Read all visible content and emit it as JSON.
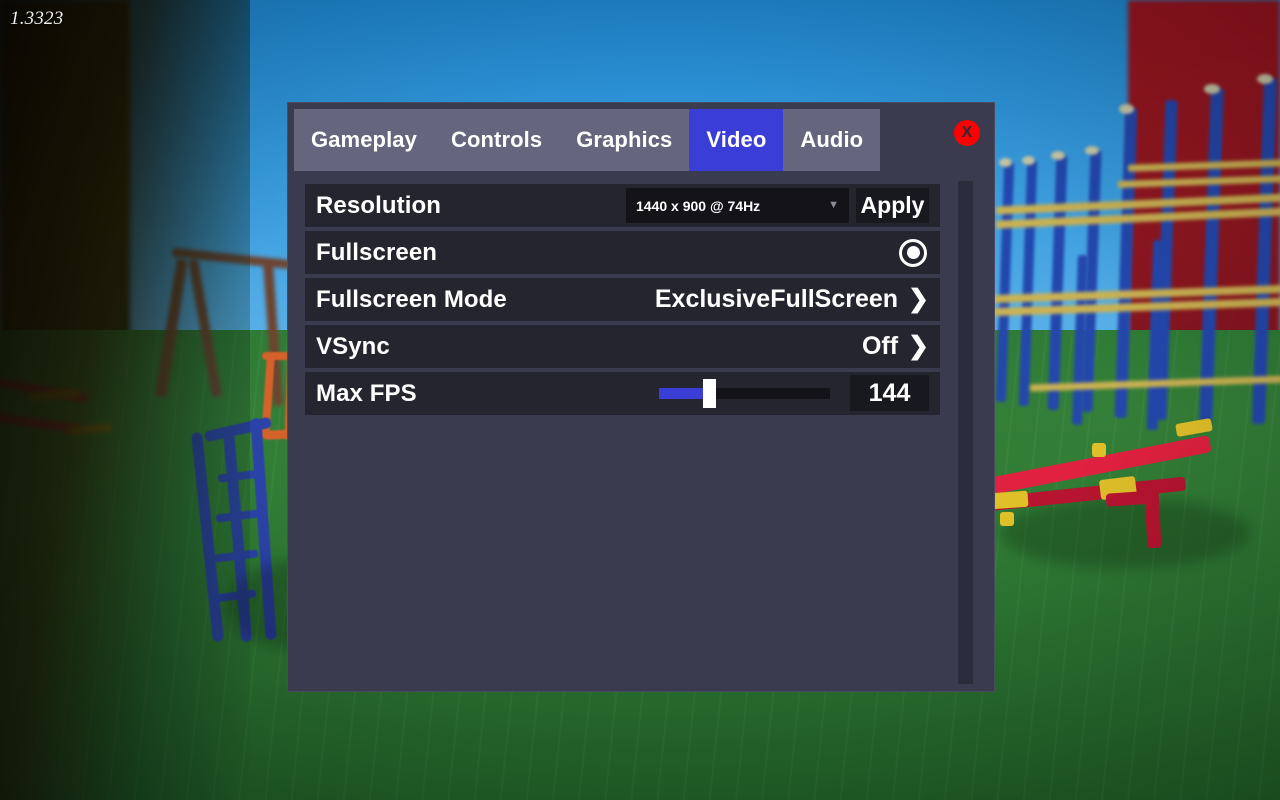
{
  "hud": {
    "fps_counter": "1.3323"
  },
  "panel": {
    "tabs": [
      {
        "label": "Gameplay",
        "active": false
      },
      {
        "label": "Controls",
        "active": false
      },
      {
        "label": "Graphics",
        "active": false
      },
      {
        "label": "Video",
        "active": true
      },
      {
        "label": "Audio",
        "active": false
      }
    ],
    "close_label": "X",
    "rows": {
      "resolution": {
        "label": "Resolution",
        "selected": "1440 x 900 @ 74Hz",
        "caret_icon": "chevron-down-icon",
        "apply_label": "Apply"
      },
      "fullscreen": {
        "label": "Fullscreen",
        "toggle_state": "on",
        "toggle_icon": "radio-filled-icon"
      },
      "fullscreen_mode": {
        "label": "Fullscreen Mode",
        "value": "ExclusiveFullScreen",
        "next_icon": "chevron-right-icon",
        "next_glyph": "❯"
      },
      "vsync": {
        "label": "VSync",
        "value": "Off",
        "next_icon": "chevron-right-icon",
        "next_glyph": "❯"
      },
      "max_fps": {
        "label": "Max FPS",
        "value": "144",
        "slider_percent": 27
      }
    }
  },
  "colors": {
    "accent_blue": "#3b3ed6",
    "panel_bg": "#3a3b4f",
    "row_bg": "#25252f",
    "tab_inactive": "#65667d",
    "close_red": "#fd0000",
    "field_bg": "#131318",
    "text": "#ffffff"
  }
}
